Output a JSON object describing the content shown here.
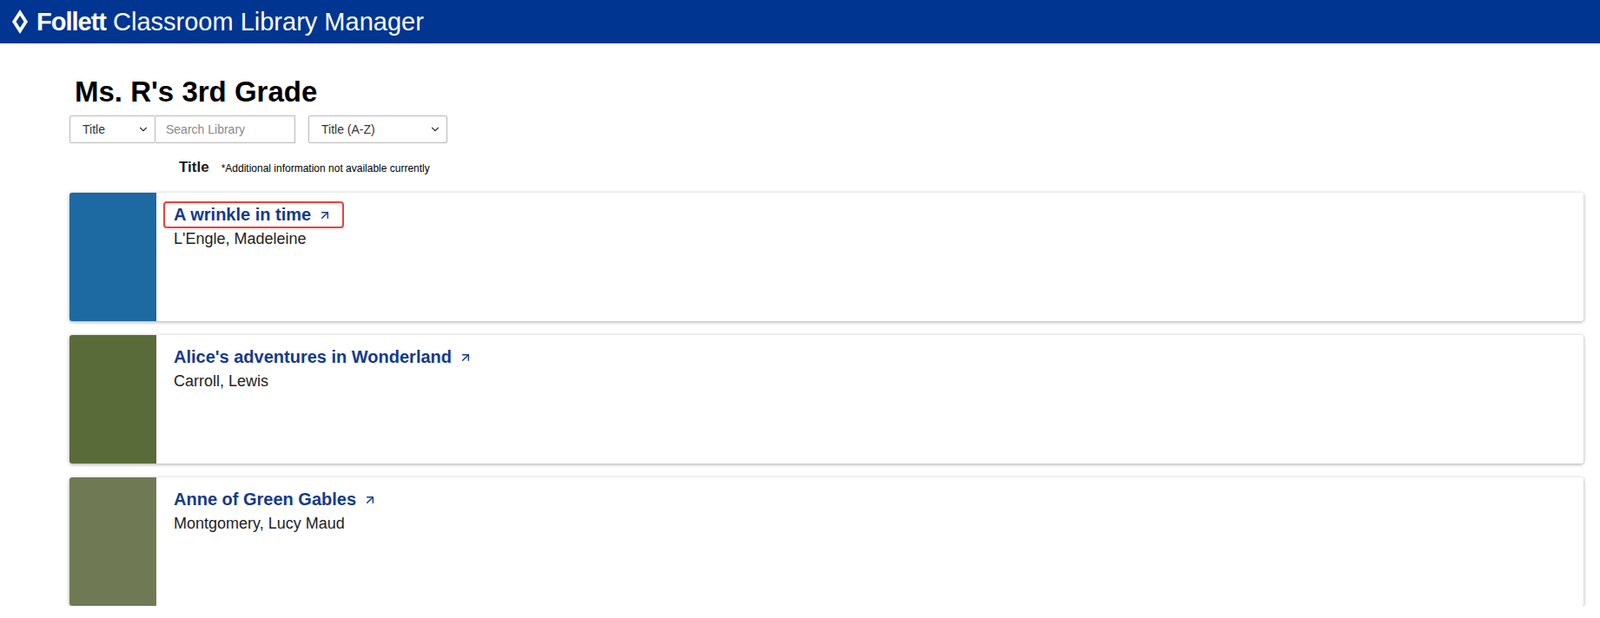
{
  "header": {
    "brand": "Follett",
    "product": "Classroom Library Manager"
  },
  "page": {
    "title": "Ms. R's 3rd Grade"
  },
  "search": {
    "field": "Title",
    "placeholder": "Search Library",
    "sort": "Title (A-Z)"
  },
  "list": {
    "column": "Title",
    "note": "*Additional information not available currently"
  },
  "books": [
    {
      "title": "A wrinkle in time",
      "author": "L'Engle, Madeleine",
      "highlighted": true,
      "color": "#1d6aa3"
    },
    {
      "title": "Alice's adventures in Wonderland",
      "author": "Carroll, Lewis",
      "highlighted": false,
      "color": "#5a6b3a"
    },
    {
      "title": "Anne of Green Gables",
      "author": "Montgomery, Lucy Maud",
      "highlighted": false,
      "color": "#6f7a55"
    }
  ]
}
